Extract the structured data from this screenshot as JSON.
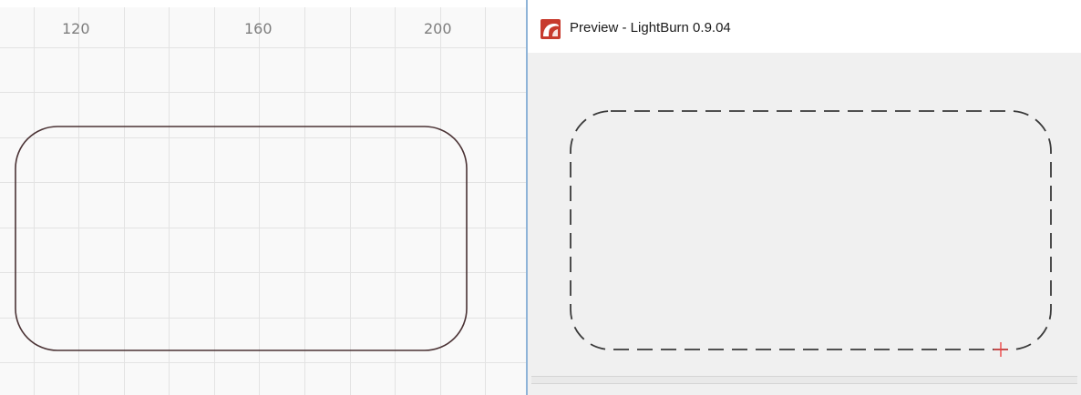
{
  "editor": {
    "ruler_labels": [
      "120",
      "160",
      "200"
    ],
    "shape": "rounded-rectangle",
    "shape_color": "#4a3234",
    "grid_color": "#e2e2e2"
  },
  "preview": {
    "window_title": "Preview - LightBurn 0.9.04",
    "app_icon": "lightburn-logo-icon",
    "accent_color": "#c73a2d",
    "path_style": "dashed",
    "laser_marker": "crosshair",
    "laser_marker_color": "#ee4444"
  }
}
